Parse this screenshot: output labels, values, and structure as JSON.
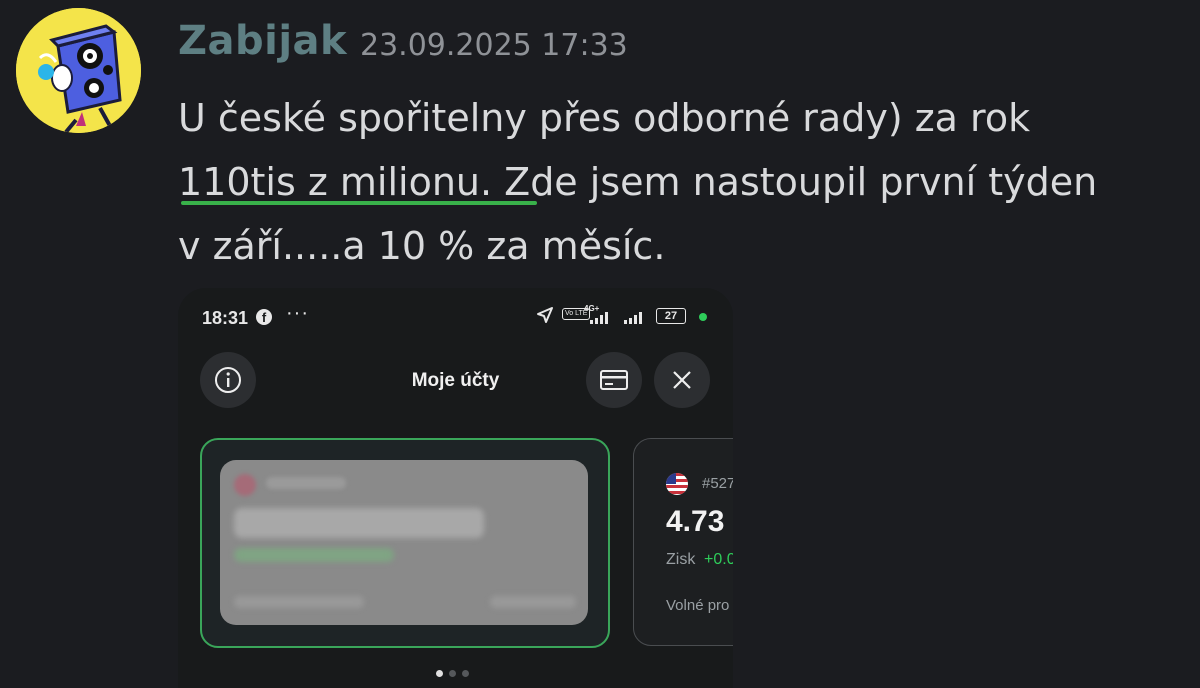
{
  "message": {
    "author": "Zabijak",
    "timestamp": "23.09.2025 17:33",
    "line1": "U české spořitelny přes odborné rady) za rok",
    "line2_highlight": "110tis z milionu.",
    "line2_rest": " Zde jsem nastoupil první týden",
    "line3": "v září.....a 10 % za měsíc."
  },
  "screenshot": {
    "status_time": "18:31",
    "status_dots": "···",
    "network": "4G+",
    "volte": "Vo LTE",
    "battery": "27",
    "title": "Moje účty",
    "side_card": {
      "account": "#527",
      "balance": "4.73",
      "profit_label": "Zisk",
      "profit_value": "+0.0",
      "free_label": "Volné pro"
    }
  },
  "icons": {
    "info": "info-icon",
    "card": "card-icon",
    "close": "close-icon",
    "location": "location-arrow-icon",
    "facebook": "facebook-icon"
  },
  "colors": {
    "background": "#1b1c20",
    "author": "#5e7f83",
    "highlight_underline": "#39b14a",
    "active_card_border": "#3aa65a",
    "profit_green": "#2ecc5a"
  }
}
